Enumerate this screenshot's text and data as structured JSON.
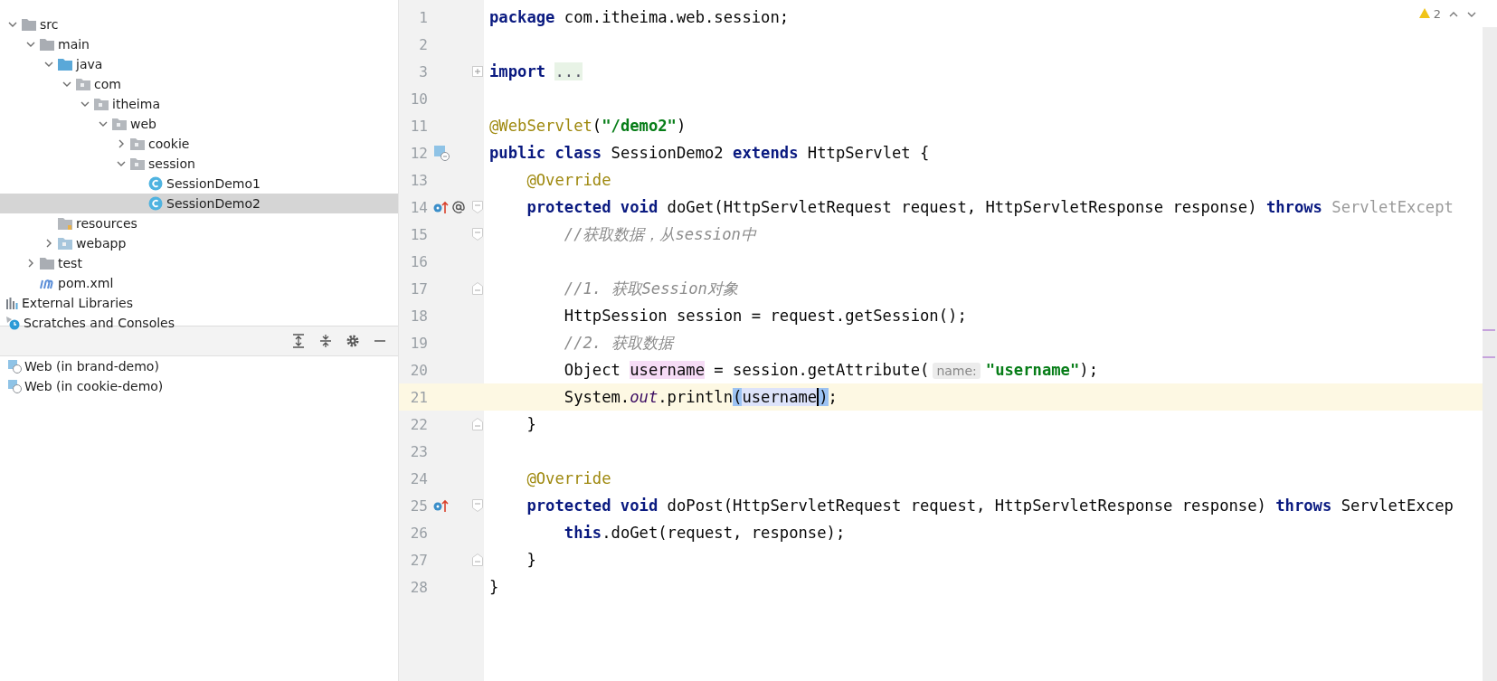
{
  "project_tree": [
    {
      "label": "src",
      "kind": "folder",
      "expanded": true,
      "selected": false,
      "children": [
        {
          "label": "main",
          "kind": "folder",
          "expanded": true,
          "selected": false,
          "children": [
            {
              "label": "java",
              "kind": "source-folder",
              "expanded": true,
              "selected": false,
              "children": [
                {
                  "label": "com",
                  "kind": "package",
                  "expanded": true,
                  "selected": false,
                  "children": [
                    {
                      "label": "itheima",
                      "kind": "package",
                      "expanded": true,
                      "selected": false,
                      "children": [
                        {
                          "label": "web",
                          "kind": "package",
                          "expanded": true,
                          "selected": false,
                          "children": [
                            {
                              "label": "cookie",
                              "kind": "package",
                              "expanded": false,
                              "selected": false
                            },
                            {
                              "label": "session",
                              "kind": "package",
                              "expanded": true,
                              "selected": false,
                              "children": [
                                {
                                  "label": "SessionDemo1",
                                  "kind": "class",
                                  "selected": false
                                },
                                {
                                  "label": "SessionDemo2",
                                  "kind": "class",
                                  "selected": true
                                }
                              ]
                            }
                          ]
                        }
                      ]
                    }
                  ]
                }
              ]
            },
            {
              "label": "resources",
              "kind": "resources",
              "selected": false
            },
            {
              "label": "webapp",
              "kind": "web-folder",
              "expanded": false,
              "selected": false
            }
          ]
        },
        {
          "label": "test",
          "kind": "folder",
          "expanded": false,
          "selected": false
        },
        {
          "label": "pom.xml",
          "kind": "maven",
          "selected": false
        }
      ]
    }
  ],
  "project_items": [
    {
      "label": "External Libraries",
      "kind": "libraries"
    },
    {
      "label": "Scratches and Consoles",
      "kind": "scratches"
    }
  ],
  "services": {
    "items": [
      {
        "label": "Web (in brand-demo)"
      },
      {
        "label": "Web (in cookie-demo)"
      }
    ]
  },
  "editor": {
    "inspections": {
      "count": "2"
    },
    "lines": [
      {
        "number": "1",
        "current": false,
        "tokens": [
          {
            "t": "package",
            "kind": "keyword"
          },
          {
            "t": " com.itheima.web.session;",
            "kind": "plain"
          }
        ]
      },
      {
        "number": "2",
        "current": false
      },
      {
        "number": "3",
        "current": false,
        "fold": {
          "kind": "collapsed"
        },
        "tokens": [
          {
            "t": "import ",
            "kind": "keyword"
          },
          {
            "t": "...",
            "kind": "folded"
          }
        ]
      },
      {
        "number": "10",
        "current": false
      },
      {
        "number": "11",
        "current": false,
        "tokens": [
          {
            "t": "@WebServlet",
            "kind": "annotation"
          },
          {
            "t": "(",
            "kind": "plain"
          },
          {
            "t": "\"/demo2\"",
            "kind": "string"
          },
          {
            "t": ")",
            "kind": "plain"
          }
        ]
      },
      {
        "number": "12",
        "current": false,
        "gutter": [
          {
            "kind": "servlet"
          }
        ],
        "tokens": [
          {
            "t": "public class",
            "kind": "keyword"
          },
          {
            "t": " SessionDemo2 ",
            "kind": "plain"
          },
          {
            "t": "extends",
            "kind": "keyword"
          },
          {
            "t": " HttpServlet {",
            "kind": "plain"
          }
        ]
      },
      {
        "number": "13",
        "current": false,
        "tokens": [
          {
            "t": "    @Override",
            "kind": "annotation"
          }
        ]
      },
      {
        "number": "14",
        "current": false,
        "gutter": [
          {
            "kind": "override"
          },
          {
            "kind": "at"
          }
        ],
        "fold": {
          "kind": "start"
        },
        "tokens": [
          {
            "t": "    protected void",
            "kind": "keyword"
          },
          {
            "t": " doGet(HttpServletRequest request, HttpServletResponse response) ",
            "kind": "plain"
          },
          {
            "t": "throws",
            "kind": "keyword"
          },
          {
            "t": " ServletExcept",
            "kind": "unused"
          }
        ]
      },
      {
        "number": "15",
        "current": false,
        "fold": {
          "kind": "start"
        },
        "tokens": [
          {
            "t": "        //获取数据，从session中",
            "kind": "comment"
          }
        ]
      },
      {
        "number": "16",
        "current": false
      },
      {
        "number": "17",
        "current": false,
        "fold": {
          "kind": "end"
        },
        "tokens": [
          {
            "t": "        //1. 获取Session对象",
            "kind": "comment"
          }
        ]
      },
      {
        "number": "18",
        "current": false,
        "tokens": [
          {
            "t": "        HttpSession session = request.getSession();",
            "kind": "plain"
          }
        ]
      },
      {
        "number": "19",
        "current": false,
        "tokens": [
          {
            "t": "        //2. 获取数据",
            "kind": "comment"
          }
        ]
      },
      {
        "number": "20",
        "current": false,
        "tokens": [
          {
            "t": "        Object ",
            "kind": "plain"
          },
          {
            "t": "username",
            "kind": "usage"
          },
          {
            "t": " = session.getAttribute(",
            "kind": "plain"
          },
          {
            "t": "name:",
            "kind": "hint"
          },
          {
            "t": "\"username\"",
            "kind": "string"
          },
          {
            "t": ");",
            "kind": "plain"
          }
        ]
      },
      {
        "number": "21",
        "current": true,
        "tokens": [
          {
            "t": "        System.",
            "kind": "plain"
          },
          {
            "t": "out",
            "kind": "field"
          },
          {
            "t": ".println",
            "kind": "plain"
          },
          {
            "t": "(",
            "kind": "brace"
          },
          {
            "t": "username",
            "kind": "match-caret"
          },
          {
            "t": ")",
            "kind": "brace"
          },
          {
            "t": ";",
            "kind": "plain"
          }
        ]
      },
      {
        "number": "22",
        "current": false,
        "fold": {
          "kind": "end"
        },
        "tokens": [
          {
            "t": "    }",
            "kind": "plain"
          }
        ]
      },
      {
        "number": "23",
        "current": false
      },
      {
        "number": "24",
        "current": false,
        "tokens": [
          {
            "t": "    @Override",
            "kind": "annotation"
          }
        ]
      },
      {
        "number": "25",
        "current": false,
        "gutter": [
          {
            "kind": "override"
          }
        ],
        "fold": {
          "kind": "start"
        },
        "tokens": [
          {
            "t": "    protected void",
            "kind": "keyword"
          },
          {
            "t": " doPost(HttpServletRequest request, HttpServletResponse response) ",
            "kind": "plain"
          },
          {
            "t": "throws",
            "kind": "keyword"
          },
          {
            "t": " ServletExcep",
            "kind": "plain"
          }
        ]
      },
      {
        "number": "26",
        "current": false,
        "tokens": [
          {
            "t": "        this",
            "kind": "keyword"
          },
          {
            "t": ".doGet(request, response);",
            "kind": "plain"
          }
        ]
      },
      {
        "number": "27",
        "current": false,
        "fold": {
          "kind": "end"
        },
        "tokens": [
          {
            "t": "    }",
            "kind": "plain"
          }
        ]
      },
      {
        "number": "28",
        "current": false,
        "tokens": [
          {
            "t": "}",
            "kind": "plain"
          }
        ]
      }
    ]
  }
}
